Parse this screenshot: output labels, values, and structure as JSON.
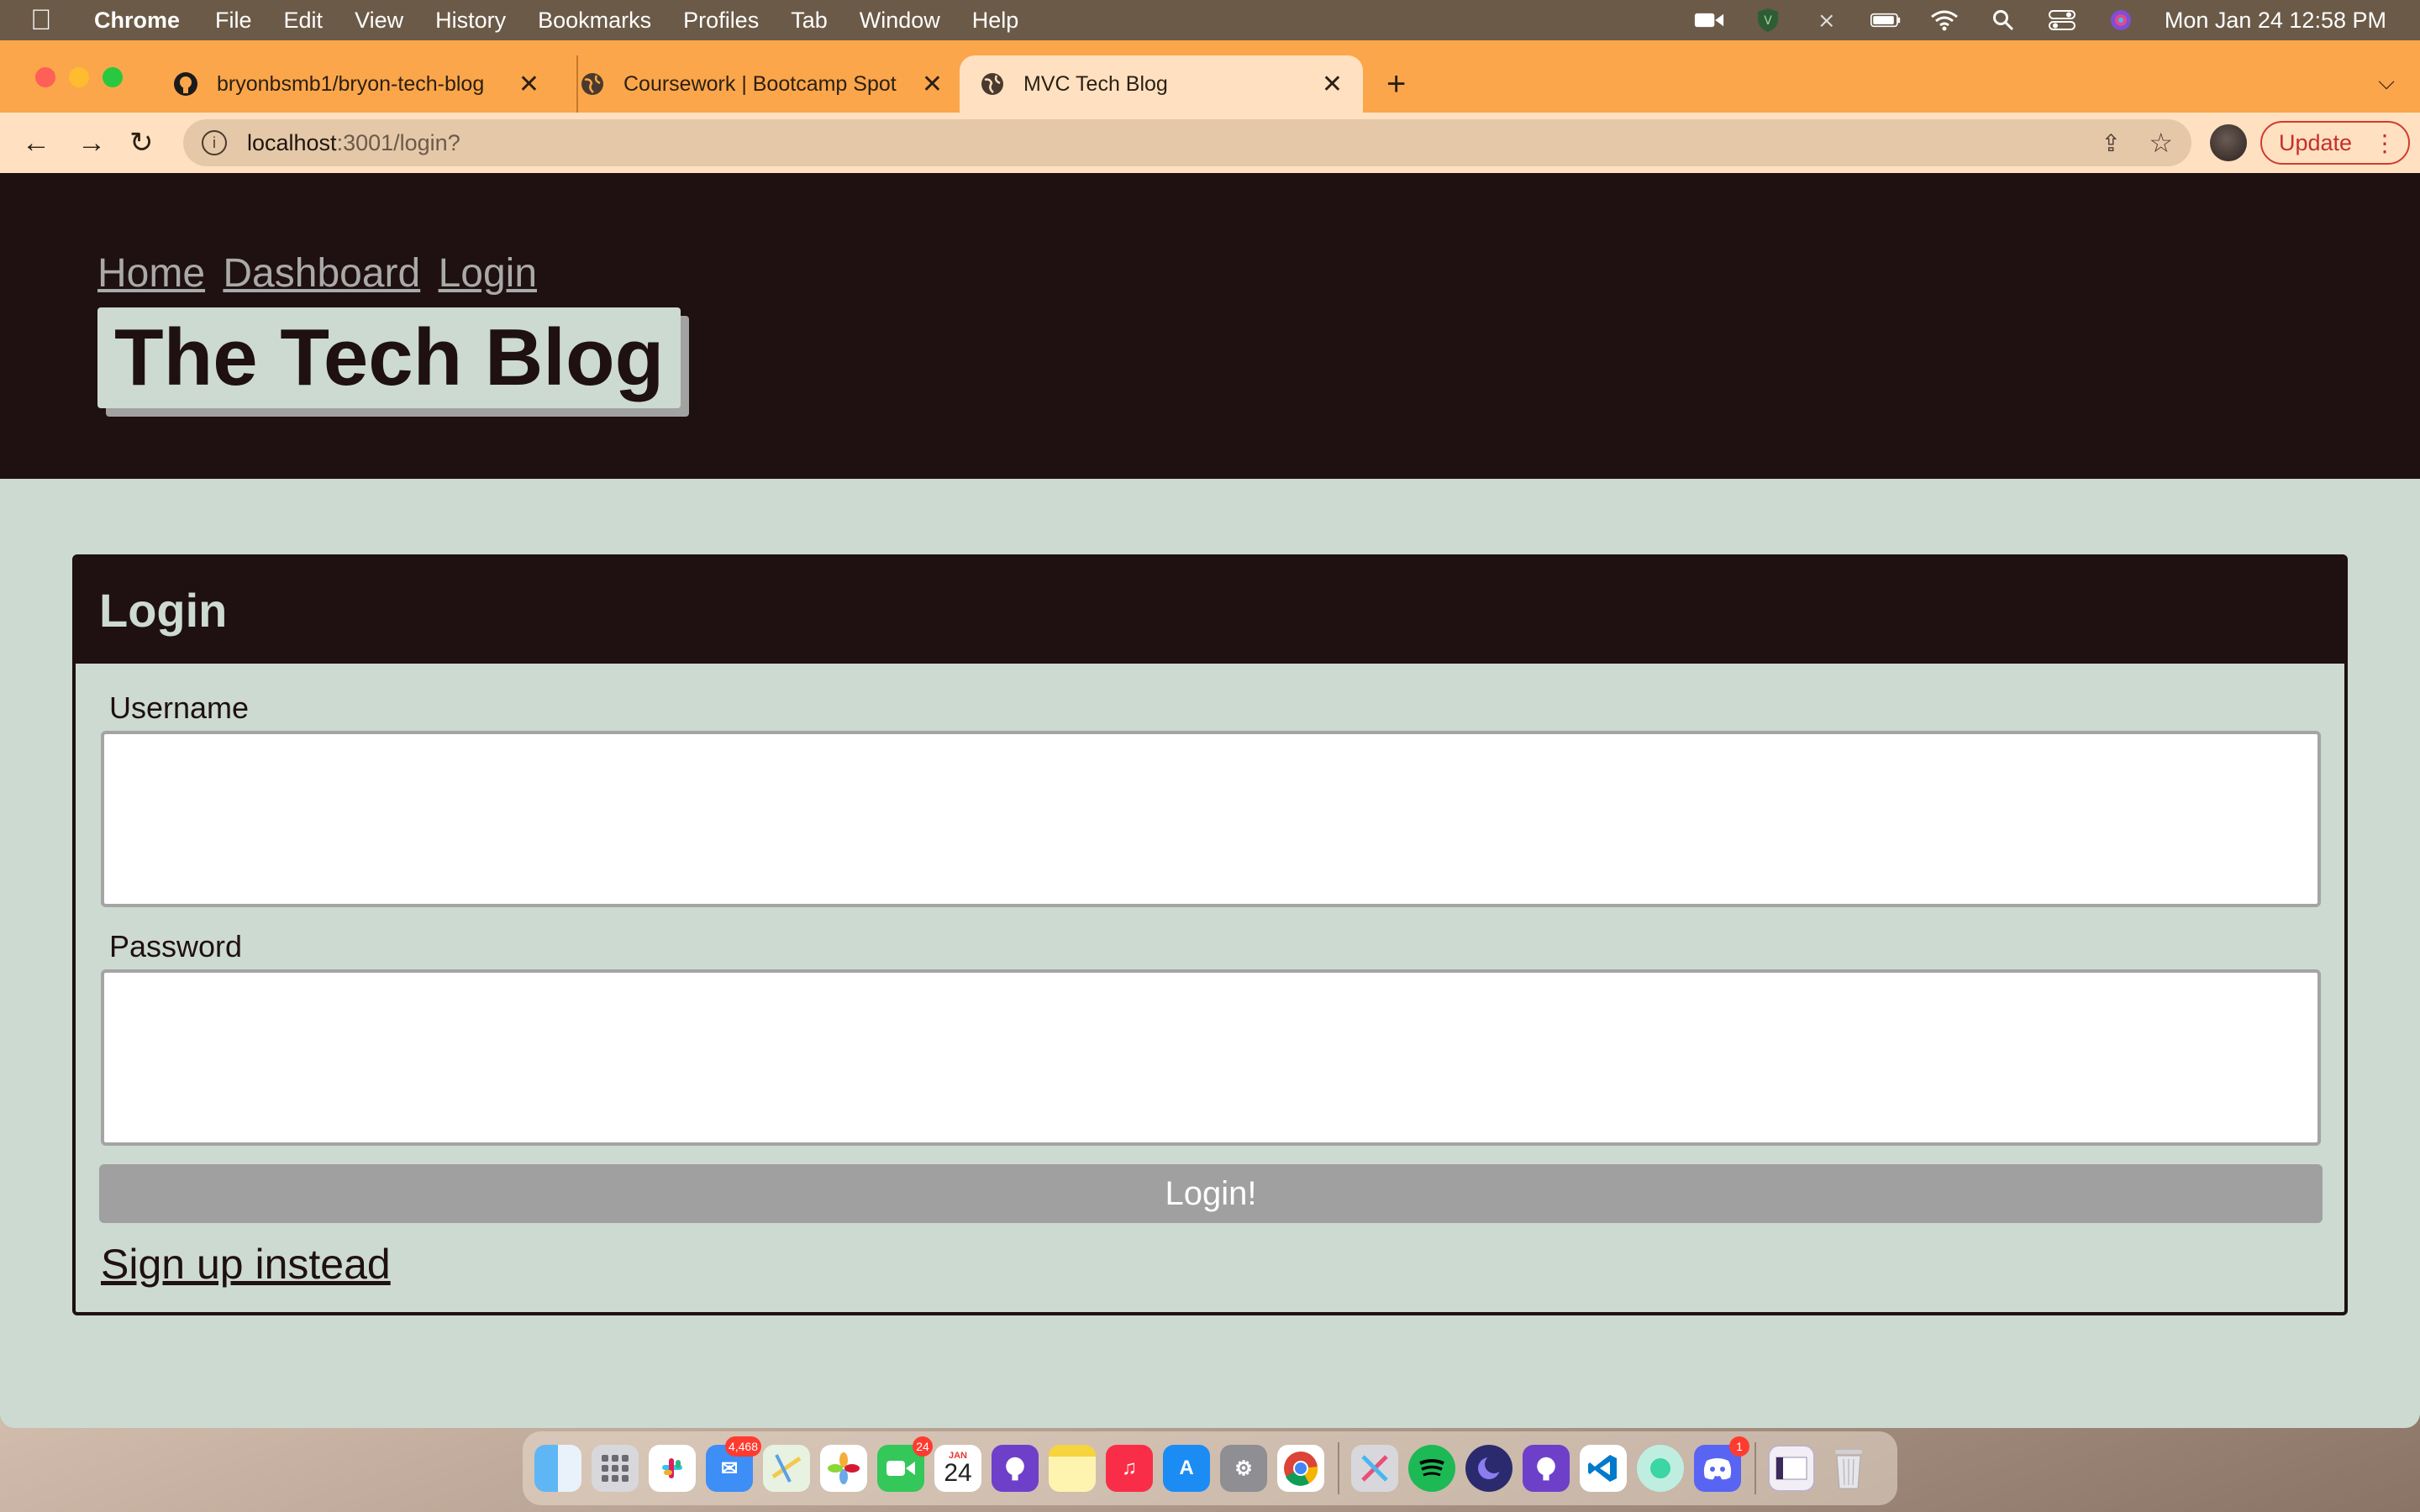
{
  "menubar": {
    "app_name": "Chrome",
    "menus": [
      "File",
      "Edit",
      "View",
      "History",
      "Bookmarks",
      "Profiles",
      "Tab",
      "Window",
      "Help"
    ],
    "clock": "Mon Jan 24  12:58 PM"
  },
  "browser": {
    "tabs": [
      {
        "title": "bryonbsmb1/bryon-tech-blog",
        "icon": "github-icon"
      },
      {
        "title": "Coursework | Bootcamp Spot",
        "icon": "globe-icon"
      },
      {
        "title": "MVC Tech Blog",
        "icon": "globe-icon",
        "active": true
      }
    ],
    "url_host": "localhost",
    "url_path": ":3001/login?",
    "update_label": "Update"
  },
  "site": {
    "nav": {
      "home": "Home",
      "dashboard": "Dashboard",
      "login": "Login"
    },
    "title": "The Tech Blog"
  },
  "login_form": {
    "heading": "Login",
    "username_label": "Username",
    "username_value": "",
    "password_label": "Password",
    "password_value": "",
    "submit_label": "Login!",
    "signup_link": "Sign up instead"
  },
  "dock": {
    "mail_badge": "4,468",
    "facetime_badge": "24",
    "calendar_month": "JAN",
    "calendar_day": "24",
    "discord_badge": "1"
  },
  "colors": {
    "tab_bar": "#fba64a",
    "header_bg": "#1f1011",
    "page_bg": "#ccdad2",
    "button_bg": "#a0a0a0"
  }
}
